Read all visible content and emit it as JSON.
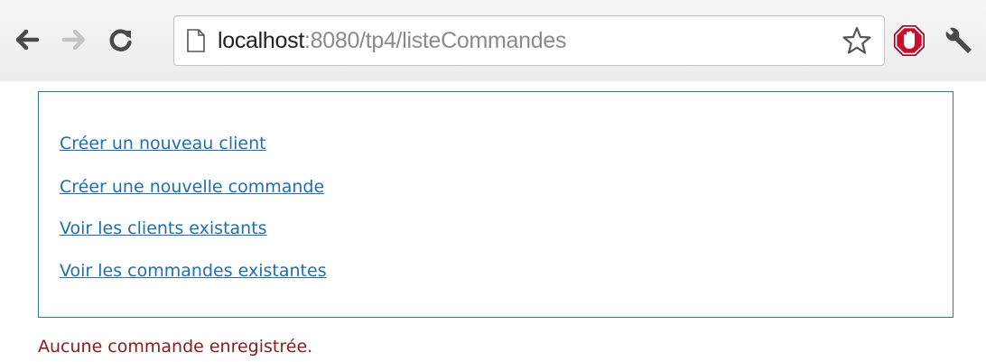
{
  "browser": {
    "url_host": "localhost",
    "url_rest": ":8080/tp4/listeCommandes",
    "icons": {
      "back": "back-arrow-icon",
      "forward": "forward-arrow-icon",
      "reload": "reload-icon",
      "page": "page-icon",
      "bookmark": "star-icon",
      "extension": "stop-hand-icon",
      "menu": "wrench-icon"
    }
  },
  "menu": {
    "links": [
      {
        "label": "Créer un nouveau client"
      },
      {
        "label": "Créer une nouvelle commande"
      },
      {
        "label": "Voir les clients existants"
      },
      {
        "label": "Voir les commandes existantes"
      }
    ],
    "border_color": "#2a78b5",
    "link_color": "#1e6eb4"
  },
  "content": {
    "message": "Aucune commande enregistrée.",
    "message_color": "#8b1a1a"
  }
}
